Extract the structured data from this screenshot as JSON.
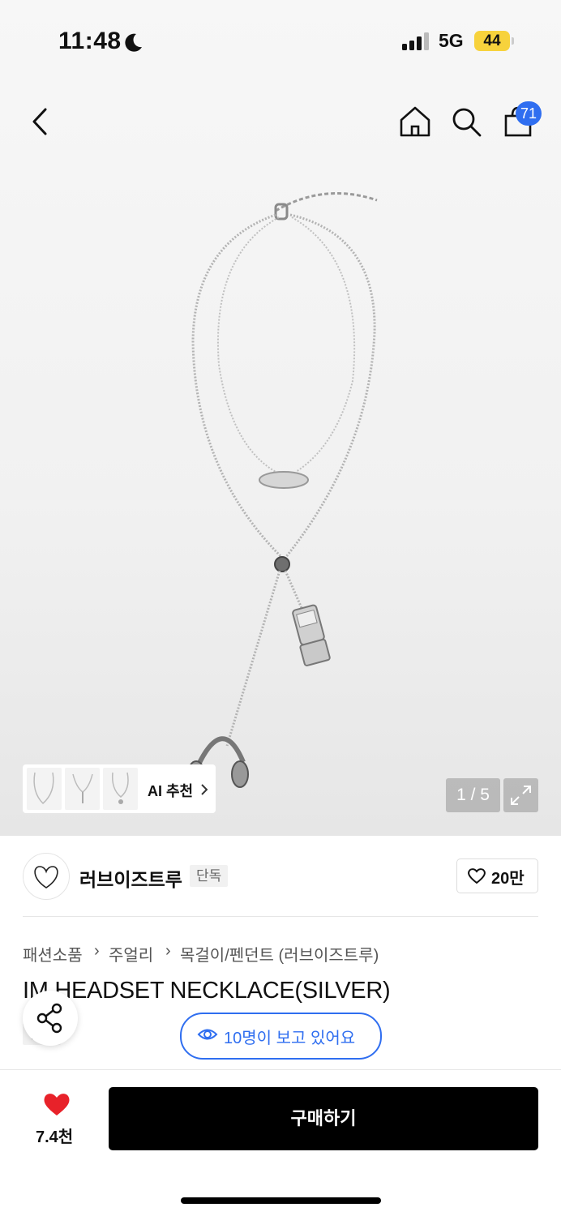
{
  "status_bar": {
    "time": "11:48",
    "network": "5G",
    "battery": "44"
  },
  "header": {
    "cart_count": "71",
    "icons": [
      "back-arrow-icon",
      "home-icon",
      "search-icon",
      "shopping-bag-icon"
    ]
  },
  "gallery": {
    "ai_recommend_label": "AI 추천",
    "page_counter": "1 / 5"
  },
  "brand": {
    "name": "러브이즈트루",
    "exclusive_badge": "단독",
    "like_count": "20만"
  },
  "breadcrumb": [
    "패션소품",
    "주얼리",
    "목걸이/펜던트 (러브이즈트루)"
  ],
  "product": {
    "title": "IM HEADSET NECKLACE(SILVER)",
    "exclusive_badge": "단독",
    "viewers_text": "10명이 보고 있어요"
  },
  "bottom_bar": {
    "like_count": "7.4천",
    "buy_label": "구매하기"
  },
  "colors": {
    "accent_blue": "#2f6ef0",
    "heart_red": "#e8222a",
    "battery_yellow": "#f7d23c"
  }
}
